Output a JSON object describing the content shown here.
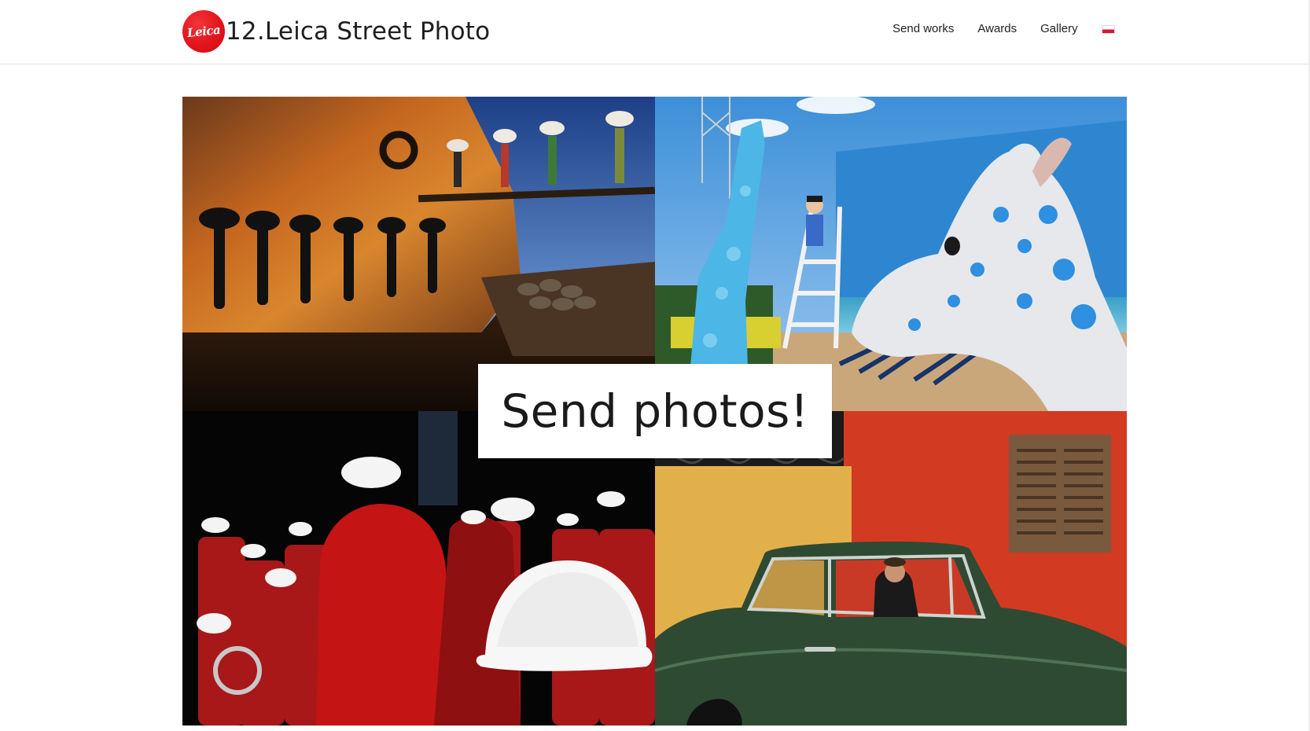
{
  "header": {
    "logo_text": "Leica",
    "site_title": "12.Leica Street Photo",
    "nav": [
      {
        "label": "Send works"
      },
      {
        "label": "Awards"
      },
      {
        "label": "Gallery"
      }
    ],
    "language_flag": "poland-flag-icon"
  },
  "hero": {
    "cta_label": "Send photos!",
    "photos": [
      {
        "subject": "porters-on-ship-plank"
      },
      {
        "subject": "child-with-blue-giraffes"
      },
      {
        "subject": "red-band-white-helmets"
      },
      {
        "subject": "man-in-green-car"
      }
    ]
  },
  "colors": {
    "brand_red": "#e2151c",
    "header_border": "#e2e2e2",
    "text": "#222222"
  }
}
